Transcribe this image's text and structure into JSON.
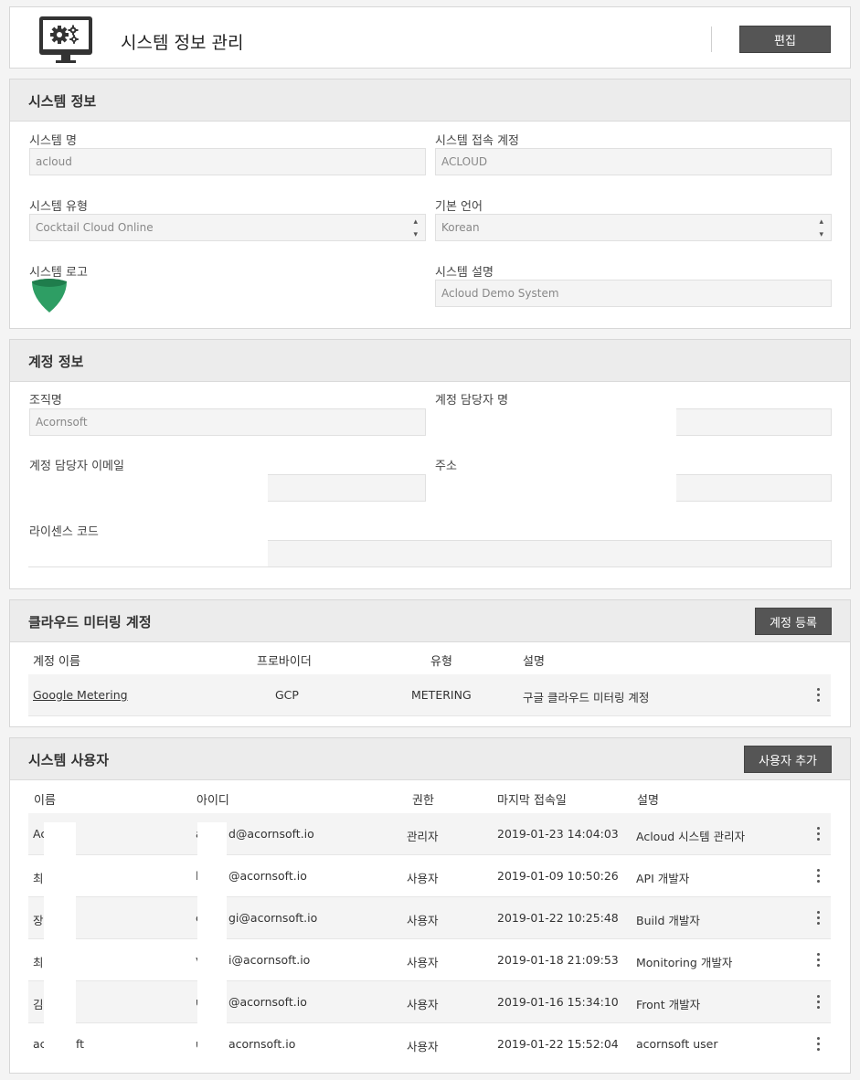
{
  "header": {
    "title": "시스템 정보 관리",
    "edit_label": "편집"
  },
  "system_info": {
    "title": "시스템 정보",
    "name_label": "시스템 명",
    "name_value": "acloud",
    "account_label": "시스템 접속 계정",
    "account_value": "ACLOUD",
    "type_label": "시스템 유형",
    "type_value": "Cocktail Cloud Online",
    "language_label": "기본 언어",
    "language_value": "Korean",
    "logo_label": "시스템 로고",
    "desc_label": "시스템 설명",
    "desc_value": "Acloud Demo System",
    "logo_color": "#2e9e64"
  },
  "account_info": {
    "title": "계정 정보",
    "org_label": "조직명",
    "org_value": "Acornsoft",
    "manager_label": "계정 담당자 명",
    "email_label": "계정 담당자 이메일",
    "address_label": "주소",
    "license_label": "라이센스 코드"
  },
  "metering": {
    "title": "클라우드 미터링 계정",
    "register_label": "계정 등록",
    "headers": [
      "계정 이름",
      "프로바이더",
      "유형",
      "설명"
    ],
    "rows": [
      {
        "name": "Google Metering",
        "provider": "GCP",
        "type": "METERING",
        "desc": "구글 클라우드 미터링 계정"
      }
    ]
  },
  "users": {
    "title": "시스템 사용자",
    "add_label": "사용자 추가",
    "headers": [
      "이름",
      "아이디",
      "권한",
      "마지막 접속일",
      "설명"
    ],
    "rows": [
      {
        "name": "Ac",
        "id_pre": "a",
        "id_post": "d@acornsoft.io",
        "role": "관리자",
        "last": "2019-01-23 14:04:03",
        "desc": "Acloud 시스템 관리자"
      },
      {
        "name": "최",
        "id_pre": "l",
        "id_post": "@acornsoft.io",
        "role": "사용자",
        "last": "2019-01-09 10:50:26",
        "desc": "API 개발자"
      },
      {
        "name": "장",
        "id_pre": "c",
        "id_post": "gi@acornsoft.io",
        "role": "사용자",
        "last": "2019-01-22 10:25:48",
        "desc": "Build 개발자"
      },
      {
        "name": "최",
        "id_pre": "v",
        "id_post": "i@acornsoft.io",
        "role": "사용자",
        "last": "2019-01-18 21:09:53",
        "desc": "Monitoring 개발자"
      },
      {
        "name": "김",
        "id_pre": "u",
        "id_post": "@acornsoft.io",
        "role": "사용자",
        "last": "2019-01-16 15:34:10",
        "desc": "Front 개발자"
      },
      {
        "name": "ac",
        "name_post": "ft",
        "id_pre": "u",
        "id_post": "acornsoft.io",
        "role": "사용자",
        "last": "2019-01-22 15:52:04",
        "desc": "acornsoft user"
      }
    ]
  }
}
